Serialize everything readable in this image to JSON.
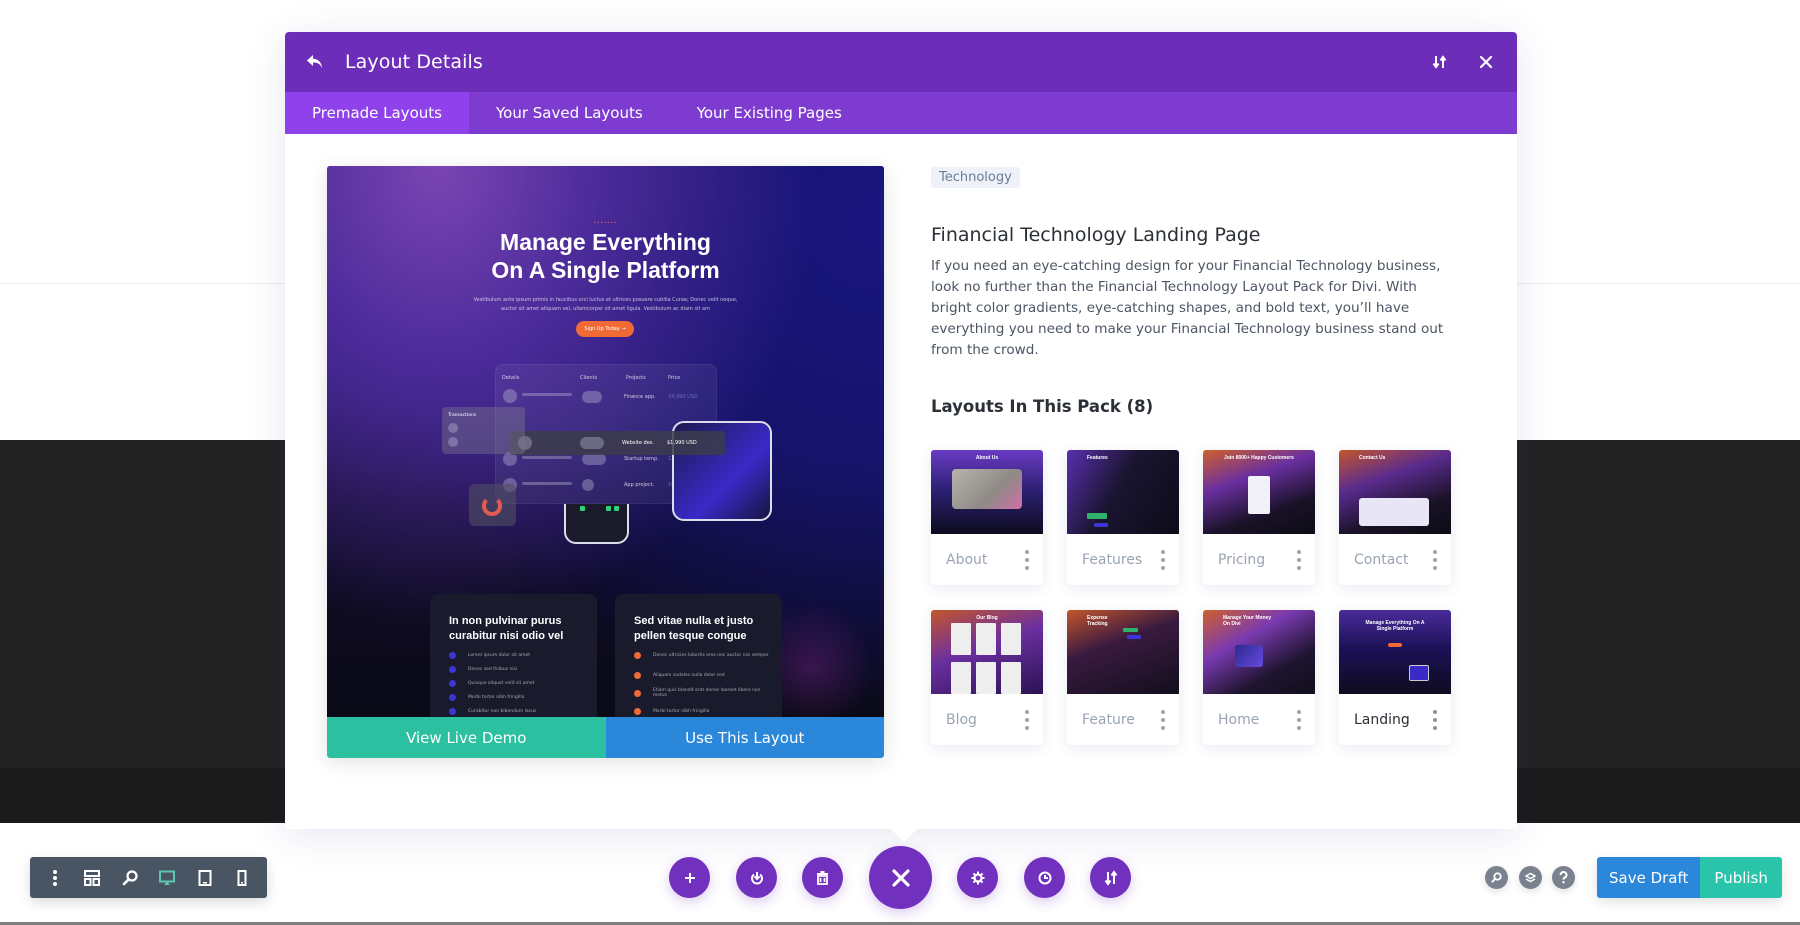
{
  "modal": {
    "title": "Layout Details",
    "back_icon": "undo-arrow-icon",
    "sort_icon": "sort-arrows-icon",
    "close_icon": "close-icon",
    "tabs": [
      {
        "label": "Premade Layouts",
        "active": true
      },
      {
        "label": "Your Saved Layouts",
        "active": false
      },
      {
        "label": "Your Existing Pages",
        "active": false
      }
    ]
  },
  "preview": {
    "headline_line1": "Manage Everything",
    "headline_line2": "On A Single Platform",
    "subtext": "Vestibulum ante ipsum primis in faucibus orci luctus et ultrices posuere cubilia Curae; Donec velit neque, auctor sit amet aliquam vel, ullamcorper sit amet ligula. Vestibulum ac diam sit am",
    "cta": "Sign Up Today →",
    "table": {
      "headers": [
        "Details",
        "Clients",
        "Projects",
        "Price"
      ],
      "rows": [
        {
          "project": "Finance app.",
          "price": "24,990 USD"
        },
        {
          "project": "Website des.",
          "price": "$1,990 USD"
        },
        {
          "project": "Startup temp.",
          "price": "12,120 USD"
        },
        {
          "project": "App project.",
          "price": "10,500 USD"
        }
      ],
      "transactions_label": "Transactions"
    },
    "card_left": {
      "title": "In non pulvinar purus curabitur nisi odio vel",
      "items": [
        "Lorem ipsum dolor sit amet",
        "Donec sed finibus nisi",
        "Quisque aliquet velit sit amet",
        "Morbi tortor nibh fringilla",
        "Curabitur non bibendum lacus"
      ]
    },
    "card_right": {
      "title": "Sed vitae nulla et justo pellen tesque congue",
      "items": [
        "Donec ultricies lobortis eros nec auctor nisi semper",
        "Aliquam sodales nulla dolor sed",
        "Etiam quis blandit erat donec laoreet libero non metus",
        "Morbi tortor nibh fringilla"
      ]
    },
    "buttons": {
      "demo": "View Live Demo",
      "use": "Use This Layout"
    }
  },
  "info": {
    "tag": "Technology",
    "title": "Financial Technology Landing Page",
    "description": "If you need an eye-catching design for your Financial Technology business, look no further than the Financial Technology Layout Pack for Divi. With bright color gradients, eye-catching shapes, and bold text, you’ll have everything you need to make your Financial Technology business stand out from the crowd.",
    "pack_title": "Layouts In This Pack (8)"
  },
  "layouts": [
    {
      "name": "About",
      "thumb_title": "About Us",
      "selected": false
    },
    {
      "name": "Features",
      "thumb_title": "Features",
      "selected": false
    },
    {
      "name": "Pricing",
      "thumb_title": "Join 8000+ Happy Customers",
      "selected": false
    },
    {
      "name": "Contact",
      "thumb_title": "Contact Us",
      "selected": false
    },
    {
      "name": "Blog",
      "thumb_title": "Our Blog",
      "selected": false
    },
    {
      "name": "Feature",
      "thumb_title": "Expense Tracking",
      "selected": false
    },
    {
      "name": "Home",
      "thumb_title": "Manage Your Money On Divi",
      "selected": false
    },
    {
      "name": "Landing",
      "thumb_title": "Manage Everything On A Single Platform",
      "selected": true
    }
  ],
  "view_toolbar": {
    "items": [
      {
        "icon": "more-vertical-icon"
      },
      {
        "icon": "wireframe-icon"
      },
      {
        "icon": "zoom-icon"
      },
      {
        "icon": "desktop-icon",
        "active": true
      },
      {
        "icon": "tablet-icon"
      },
      {
        "icon": "phone-icon"
      }
    ]
  },
  "center_toolbar": {
    "items": [
      {
        "icon": "add-icon"
      },
      {
        "icon": "portability-icon"
      },
      {
        "icon": "trash-icon"
      },
      {
        "icon": "close-icon"
      },
      {
        "icon": "settings-icon"
      },
      {
        "icon": "history-icon"
      },
      {
        "icon": "sort-arrows-icon"
      }
    ]
  },
  "right_toolbar": {
    "utility_icons": [
      "search-icon",
      "layers-icon",
      "help-icon"
    ],
    "save_draft": "Save Draft",
    "publish": "Publish"
  },
  "colors": {
    "header": "#6c2eb9",
    "tabs": "#7e3bd0",
    "active_tab": "#8f42ec",
    "demo_button": "#2bc0a0",
    "use_button": "#2b87da",
    "publish": "#29c4a9",
    "fab": "#7130bd",
    "desktop_active": "#5fc7b0"
  }
}
